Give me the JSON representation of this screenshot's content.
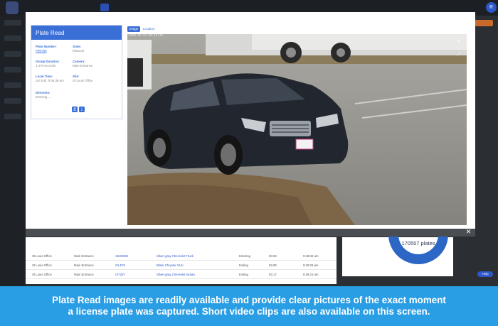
{
  "background_app": {
    "avatar_initial": "R",
    "rows": [
      {
        "site": "St Louis Office",
        "camera": "Main Entrance",
        "plate": "1S2029D",
        "vehicle": "Silver-gray Chevrolet Truck",
        "direction": "Entering",
        "dur": "93.53",
        "time": "9:48:32 am"
      },
      {
        "site": "St Louis Office",
        "camera": "Main Entrance",
        "plate": "CIL575",
        "vehicle": "Black Chrysler SUV",
        "direction": "Exiting",
        "dur": "93.09",
        "time": "9:48:29 am"
      },
      {
        "site": "St Louis Office",
        "camera": "Main Entrance",
        "plate": "CF1BY",
        "vehicle": "Silver-gray Chevrolet Sedan",
        "direction": "Exiting",
        "dur": "93.17",
        "time": "9:48:23 am"
      }
    ],
    "donut_label": "170557 plates",
    "help_label": "Help"
  },
  "modal": {
    "card_title": "Plate Read",
    "fields": {
      "plate_number_label": "Plate Number:",
      "plate_number_value": "P85Y60",
      "state_label": "State:",
      "state_value": "Missouri",
      "group_duration_label": "Group Duration:",
      "group_duration_value": "1.376 seconds",
      "camera_label": "Camera:",
      "camera_value": "Main Entrance",
      "local_time_label": "Local Time:",
      "local_time_value": "Jul 24th, 9:48:39 am",
      "site_label": "Site:",
      "site_value": "St Louis Office",
      "direction_label": "Direction:",
      "direction_value": "Entering →"
    },
    "tabs": [
      "Image",
      "Location"
    ],
    "timestamp": "2019-07-24 09:48:39",
    "close_glyph": "✕",
    "zoom_in_glyph": "+",
    "zoom_fit_glyph": "⤢",
    "print_glyph": "⎙",
    "download_glyph": "⤓"
  },
  "caption": "Plate Read images are readily available and provide clear pictures of the exact moment a license plate was captured. Short video clips are also available on this screen.",
  "colors": {
    "accent": "#3a6fd8",
    "banner": "#2a9ee4"
  }
}
